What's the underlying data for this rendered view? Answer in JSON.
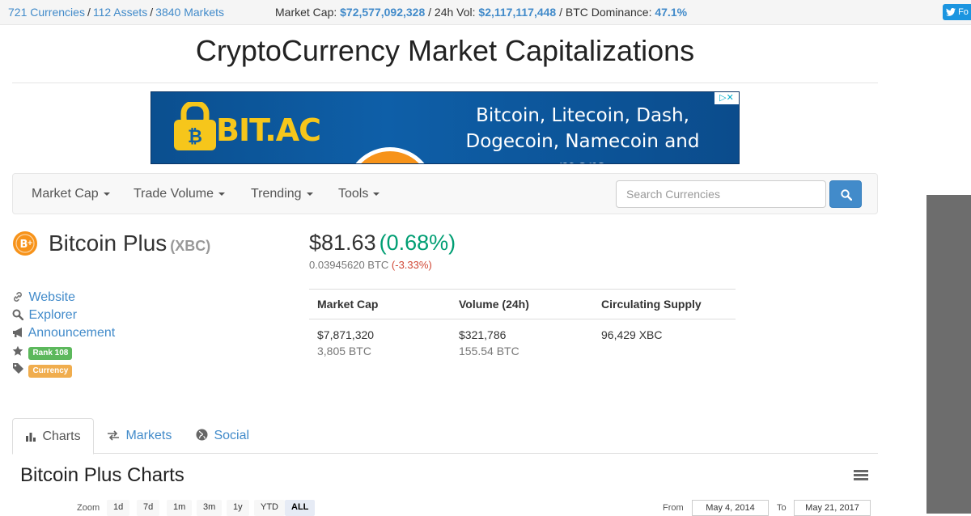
{
  "topbar": {
    "currencies": "721 Currencies",
    "assets": "112 Assets",
    "markets": "3840 Markets",
    "market_cap_label": "Market Cap:",
    "market_cap_value": "$72,577,092,328",
    "volume_label": "/ 24h Vol:",
    "volume_value": "$2,117,117,448",
    "dominance_label": "/ BTC Dominance:",
    "dominance_value": "47.1%",
    "follow_label": "Fo"
  },
  "page": {
    "title": "CryptoCurrency Market Capitalizations"
  },
  "banner": {
    "brand": "BIT.AC",
    "tagline_line1": "Bitcoin, Litecoin, Dash,",
    "tagline_line2": "Dogecoin, Namecoin and more"
  },
  "navbar": {
    "items": [
      {
        "label": "Market Cap"
      },
      {
        "label": "Trade Volume"
      },
      {
        "label": "Trending"
      },
      {
        "label": "Tools"
      }
    ],
    "search_placeholder": "Search Currencies"
  },
  "coin": {
    "name": "Bitcoin Plus",
    "symbol": "(XBC)",
    "price_usd": "$81.63",
    "price_change": "(0.68%)",
    "price_btc": "0.03945620 BTC",
    "price_btc_change": "(-3.33%)",
    "links": {
      "website": "Website",
      "explorer": "Explorer",
      "announcement": "Announcement"
    },
    "rank": "Rank 108",
    "type": "Currency"
  },
  "stats": {
    "headers": [
      "Market Cap",
      "Volume (24h)",
      "Circulating Supply"
    ],
    "market_cap_usd": "$7,871,320",
    "market_cap_btc": "3,805 BTC",
    "volume_usd": "$321,786",
    "volume_btc": "155.54 BTC",
    "supply": "96,429 XBC"
  },
  "tabs": [
    {
      "label": "Charts"
    },
    {
      "label": "Markets"
    },
    {
      "label": "Social"
    }
  ],
  "charts": {
    "title": "Bitcoin Plus Charts",
    "zoom_label": "Zoom",
    "zoom_options": [
      "1d",
      "7d",
      "1m",
      "3m",
      "1y",
      "YTD",
      "ALL"
    ],
    "active_zoom": "ALL",
    "from_label": "From",
    "from_value": "May 4, 2014",
    "to_label": "To",
    "to_value": "May 21, 2017"
  },
  "colors": {
    "link": "#428bca",
    "positive": "#009e73",
    "negative": "#d14836",
    "rank_badge": "#5cb85c",
    "type_badge": "#f0ad4e"
  }
}
